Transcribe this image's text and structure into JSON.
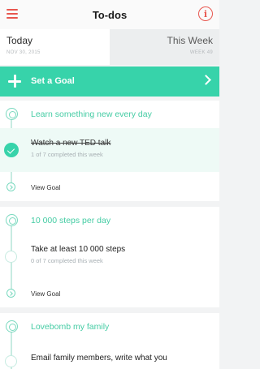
{
  "header": {
    "title": "To-dos",
    "info_glyph": "i"
  },
  "tabs": [
    {
      "label": "Today",
      "sublabel": "NOV 30, 2015"
    },
    {
      "label": "This Week",
      "sublabel": "WEEK 49"
    }
  ],
  "set_goal": {
    "label": "Set a Goal"
  },
  "goals": [
    {
      "title": "Learn something new every day",
      "task": {
        "title": "Watch a new TED talk",
        "progress": "1 of 7 completed this week",
        "completed": true
      },
      "view_label": "View Goal"
    },
    {
      "title": "10 000 steps per day",
      "task": {
        "title": "Take at least 10 000 steps",
        "progress": "0 of 7 completed this week",
        "completed": false
      },
      "view_label": "View Goal"
    },
    {
      "title": "Lovebomb my family",
      "task": {
        "title": "Email family members, write what you",
        "completed": false
      }
    }
  ],
  "colors": {
    "accent_red": "#e8574f",
    "accent_green": "#37d3aa",
    "goal_text": "#45cca4"
  }
}
